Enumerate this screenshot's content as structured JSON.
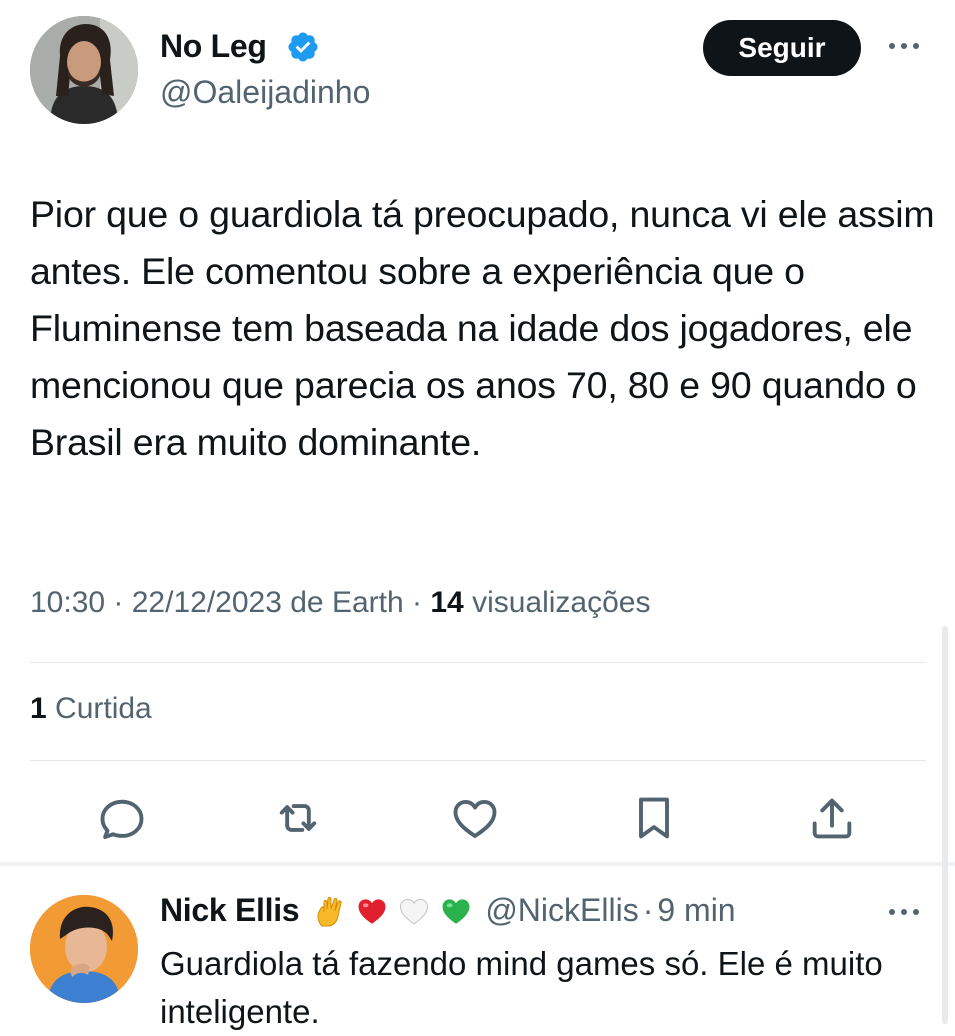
{
  "tweet": {
    "author_name": "No Leg",
    "author_handle": "@Oaleijadinho",
    "follow_label": "Seguir",
    "text": "Pior que o guardiola tá preocupado, nunca vi ele assim antes. Ele comentou sobre a experiência que o Fluminense tem baseada na idade dos jogadores, ele mencionou que parecia os anos 70, 80 e 90 quando o Brasil era muito dominante.",
    "time": "10:30",
    "date": "22/12/2023",
    "source": "de Earth",
    "views_count": "14",
    "views_label": "visualizações",
    "likes_count": "1",
    "likes_label": "Curtida",
    "icons": {
      "verified": "verified-badge-icon",
      "more": "more-options-icon",
      "reply": "reply-icon",
      "retweet": "retweet-icon",
      "like": "heart-icon",
      "bookmark": "bookmark-icon",
      "share": "share-icon"
    }
  },
  "reply": {
    "author_name": "Nick Ellis",
    "emojis": [
      "vulcan-salute",
      "red-heart",
      "white-heart",
      "green-heart"
    ],
    "author_handle": "@NickEllis",
    "separator": "·",
    "time": "9 min",
    "text": "Guardiola tá fazendo mind games só. Ele é muito inteligente."
  },
  "colors": {
    "text": "#0f1419",
    "secondary": "#536471",
    "verified": "#1d9bf0",
    "button_bg": "#0f1419"
  }
}
